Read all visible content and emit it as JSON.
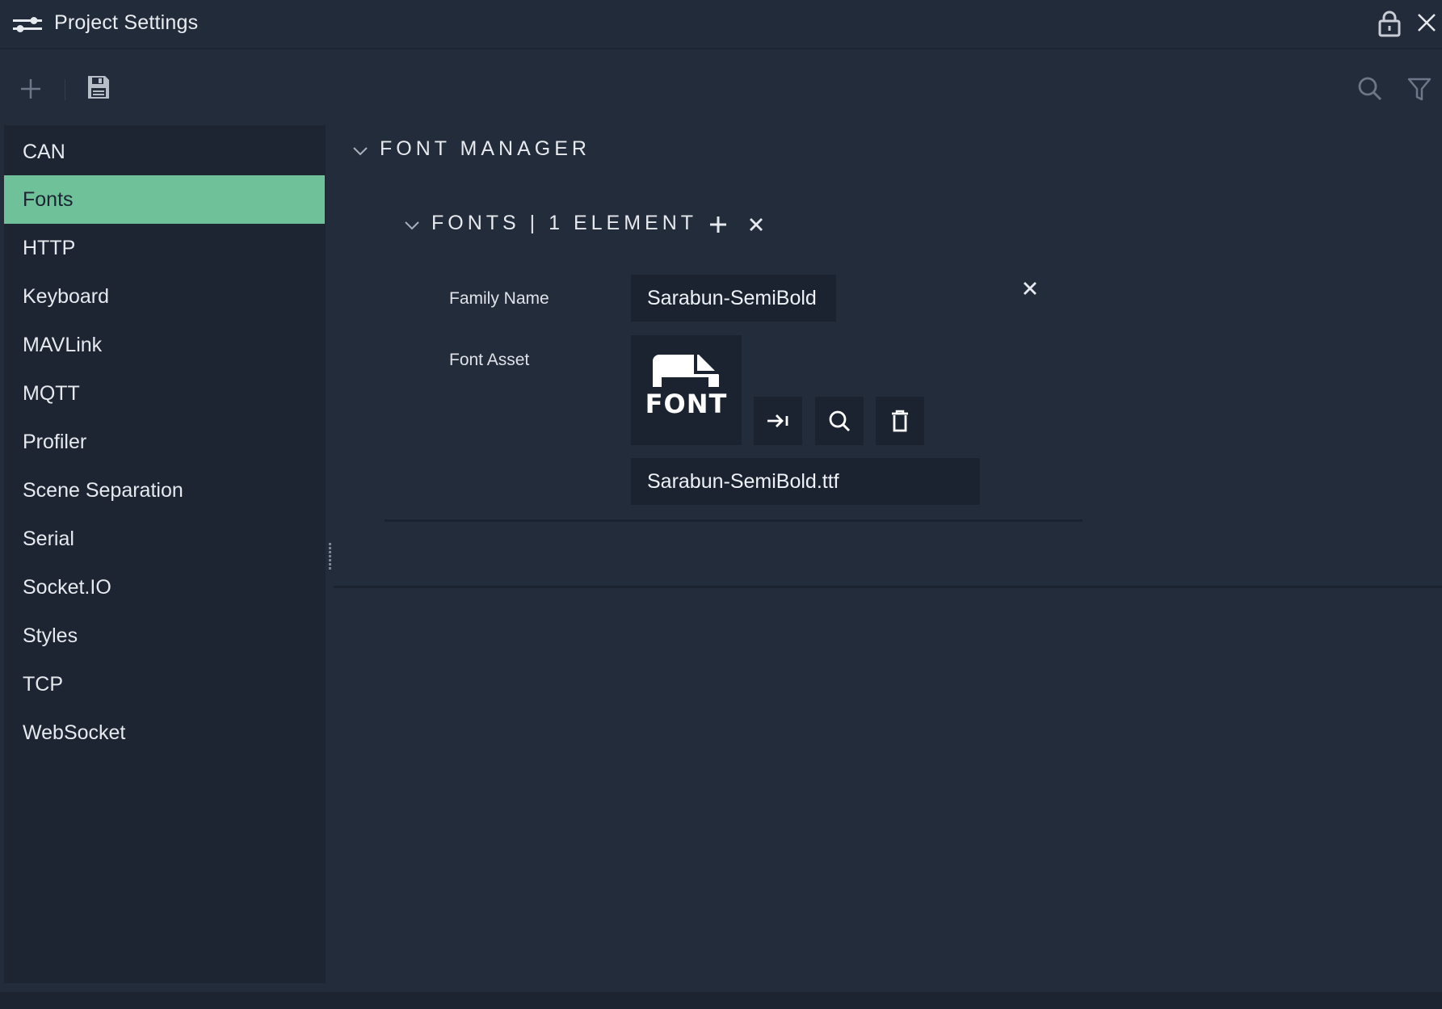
{
  "window": {
    "title": "Project Settings"
  },
  "toolbar": {
    "add_icon": "plus-icon",
    "save_icon": "floppy-disk-icon",
    "search_icon": "search-icon",
    "filter_icon": "filter-icon"
  },
  "sidebar": {
    "items": [
      {
        "label": "CAN",
        "active": false
      },
      {
        "label": "Fonts",
        "active": true
      },
      {
        "label": "HTTP",
        "active": false
      },
      {
        "label": "Keyboard",
        "active": false
      },
      {
        "label": "MAVLink",
        "active": false
      },
      {
        "label": "MQTT",
        "active": false
      },
      {
        "label": "Profiler",
        "active": false
      },
      {
        "label": "Scene Separation",
        "active": false
      },
      {
        "label": "Serial",
        "active": false
      },
      {
        "label": "Socket.IO",
        "active": false
      },
      {
        "label": "Styles",
        "active": false
      },
      {
        "label": "TCP",
        "active": false
      },
      {
        "label": "WebSocket",
        "active": false
      }
    ]
  },
  "main": {
    "section_title": "FONT MANAGER",
    "list_title": "FONTS | 1 ELEMENT",
    "font_entry": {
      "family_name_label": "Family Name",
      "family_name_value": "Sarabun-SemiBold",
      "font_asset_label": "Font Asset",
      "asset_thumbnail_text": "FONT",
      "asset_filename": "Sarabun-SemiBold.ttf"
    }
  },
  "colors": {
    "accent_active": "#6fc19a",
    "background": "#232c3b",
    "sidebar_bg": "#1d2533",
    "field_bg": "#1b2230"
  }
}
